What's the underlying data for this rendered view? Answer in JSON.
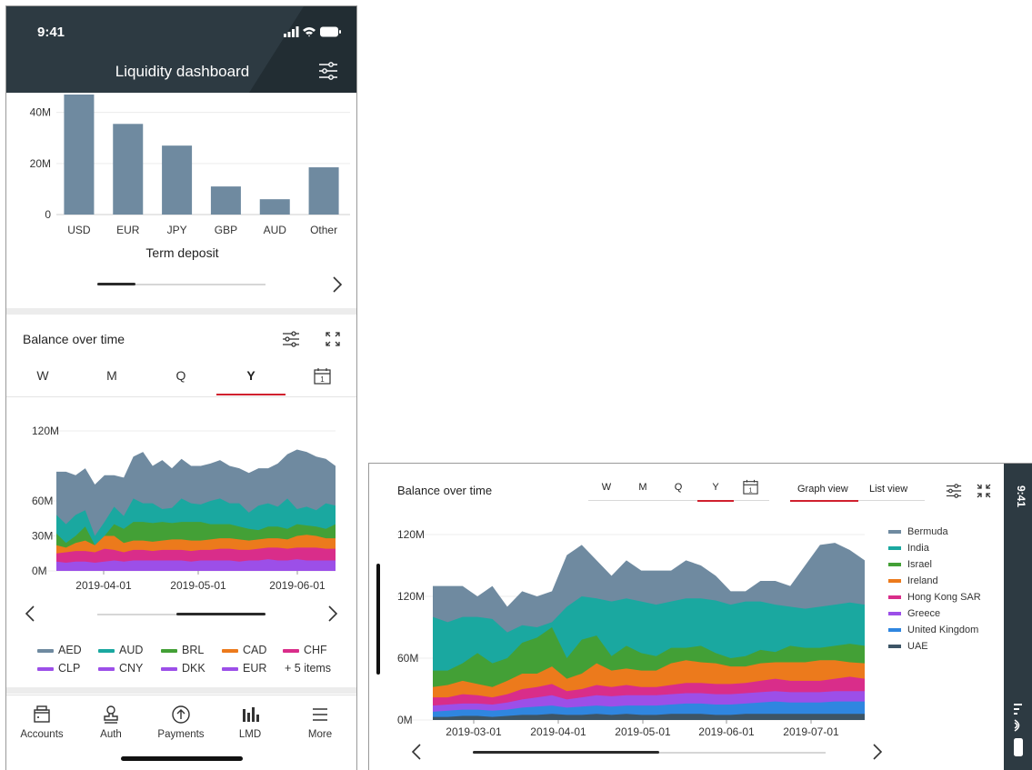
{
  "phone": {
    "status_time": "9:41",
    "header_title": "Liquidity dashboard",
    "filter_icon": "sliders-icon",
    "term_chart_title": "Term deposit",
    "balance_title": "Balance over time",
    "tabs": [
      "W",
      "M",
      "Q",
      "Y"
    ],
    "active_tab": "Y",
    "calendar_icon": "calendar-icon",
    "calendar_day": "1",
    "legend": [
      {
        "label": "AED",
        "color": "#6f8aa0"
      },
      {
        "label": "AUD",
        "color": "#1aa8a0"
      },
      {
        "label": "BRL",
        "color": "#43a036"
      },
      {
        "label": "CAD",
        "color": "#ec7a1c"
      },
      {
        "label": "CHF",
        "color": "#d92d8a"
      },
      {
        "label": "CLP",
        "color": "#9c4fe8"
      },
      {
        "label": "CNY",
        "color": "#9c4fe8"
      },
      {
        "label": "DKK",
        "color": "#9c4fe8"
      },
      {
        "label": "EUR",
        "color": "#9c4fe8"
      }
    ],
    "legend_more": "+ 5 items",
    "nav": [
      {
        "label": "Accounts",
        "icon": "accounts-icon"
      },
      {
        "label": "Auth",
        "icon": "auth-stamp-icon"
      },
      {
        "label": "Payments",
        "icon": "payments-icon"
      },
      {
        "label": "LMD",
        "icon": "lmd-bars-icon"
      },
      {
        "label": "More",
        "icon": "menu-icon"
      }
    ]
  },
  "landscape": {
    "title": "Balance over time",
    "tabs": [
      "W",
      "M",
      "Q",
      "Y"
    ],
    "active_tab": "Y",
    "calendar_day": "1",
    "views": [
      "Graph view",
      "List view"
    ],
    "active_view": "Graph view",
    "status_time": "9:41",
    "legend": [
      {
        "label": "Bermuda",
        "color": "#6f8aa0"
      },
      {
        "label": "India",
        "color": "#1aa8a0"
      },
      {
        "label": "Israel",
        "color": "#43a036"
      },
      {
        "label": "Ireland",
        "color": "#ec7a1c"
      },
      {
        "label": "Hong Kong SAR",
        "color": "#d92d8a"
      },
      {
        "label": "Greece",
        "color": "#9c4fe8"
      },
      {
        "label": "United Kingdom",
        "color": "#2f86e0"
      },
      {
        "label": "UAE",
        "color": "#3d5566"
      }
    ]
  },
  "chart_data": [
    {
      "type": "bar",
      "title": "Term deposit",
      "categories": [
        "USD",
        "EUR",
        "JPY",
        "GBP",
        "AUD",
        "Other"
      ],
      "values": [
        47,
        35.5,
        27,
        11,
        6,
        18.5
      ],
      "ylim": [
        0,
        47
      ],
      "yticks": [
        {
          "v": 0,
          "label": "0"
        },
        {
          "v": 20,
          "label": "20M"
        },
        {
          "v": 40,
          "label": "40M"
        }
      ],
      "grid": true,
      "bar_color": "#6f8aa0"
    },
    {
      "type": "area",
      "title": "Balance over time",
      "x_labels": [
        "2019-04-01",
        "2019-05-01",
        "2019-06-01"
      ],
      "y_ticks": [
        {
          "v": 0,
          "label": "0M"
        },
        {
          "v": 30,
          "label": "30M"
        },
        {
          "v": 60,
          "label": "60M"
        },
        {
          "v": 120,
          "label": "120M"
        }
      ],
      "ylim": [
        0,
        120
      ],
      "series": [
        {
          "name": "AED",
          "color": "#6f8aa0",
          "values": [
            85,
            85,
            82,
            88,
            74,
            82,
            82,
            80,
            98,
            102,
            90,
            95,
            88,
            96,
            90,
            90,
            92,
            95,
            90,
            88,
            84,
            88,
            88,
            92,
            100,
            104,
            102,
            98,
            96,
            90
          ]
        },
        {
          "name": "AUD",
          "color": "#1aa8a0",
          "values": [
            48,
            40,
            48,
            52,
            30,
            42,
            55,
            47,
            62,
            58,
            58,
            53,
            54,
            62,
            58,
            57,
            60,
            62,
            58,
            58,
            50,
            56,
            58,
            55,
            62,
            53,
            55,
            52,
            58,
            56
          ]
        },
        {
          "name": "BRL",
          "color": "#43a036",
          "values": [
            32,
            24,
            30,
            38,
            22,
            30,
            40,
            36,
            42,
            42,
            41,
            42,
            41,
            42,
            42,
            42,
            40,
            40,
            40,
            38,
            36,
            35,
            38,
            38,
            36,
            40,
            39,
            38,
            36,
            40
          ]
        },
        {
          "name": "CAD",
          "color": "#ec7a1c",
          "values": [
            22,
            20,
            24,
            26,
            22,
            30,
            30,
            24,
            26,
            26,
            25,
            26,
            27,
            27,
            26,
            26,
            27,
            28,
            28,
            27,
            26,
            27,
            28,
            28,
            27,
            30,
            31,
            30,
            28,
            28
          ]
        },
        {
          "name": "CHF",
          "color": "#d92d8a",
          "values": [
            15,
            16,
            17,
            17,
            16,
            19,
            18,
            16,
            18,
            18,
            17,
            18,
            18,
            18,
            17,
            18,
            18,
            19,
            19,
            18,
            18,
            19,
            20,
            20,
            19,
            20,
            20,
            20,
            19,
            19
          ]
        },
        {
          "name": "EUR",
          "color": "#9c4fe8",
          "values": [
            8,
            7,
            8,
            8,
            7,
            8,
            9,
            8,
            9,
            9,
            9,
            9,
            9,
            9,
            8,
            9,
            9,
            9,
            9,
            8,
            9,
            9,
            10,
            9,
            9,
            10,
            9,
            9,
            9,
            9
          ]
        }
      ]
    },
    {
      "type": "area",
      "title": "Balance over time",
      "x_labels": [
        "2019-03-01",
        "2019-04-01",
        "2019-05-01",
        "2019-06-01",
        "2019-07-01"
      ],
      "y_ticks": [
        {
          "v": 0,
          "label": "0M"
        },
        {
          "v": 60,
          "label": "60M"
        },
        {
          "v": 120,
          "label": "120M"
        },
        {
          "v": 180,
          "label": "120M"
        }
      ],
      "ylim": [
        0,
        180
      ],
      "series": [
        {
          "name": "Bermuda",
          "color": "#6f8aa0",
          "values": [
            130,
            130,
            130,
            120,
            130,
            110,
            125,
            120,
            125,
            160,
            170,
            155,
            140,
            155,
            145,
            145,
            145,
            155,
            150,
            140,
            125,
            125,
            135,
            135,
            130,
            150,
            170,
            172,
            165,
            155
          ]
        },
        {
          "name": "India",
          "color": "#1aa8a0",
          "values": [
            100,
            95,
            100,
            100,
            98,
            85,
            92,
            90,
            95,
            110,
            120,
            118,
            115,
            118,
            115,
            112,
            115,
            118,
            118,
            116,
            112,
            115,
            115,
            112,
            110,
            108,
            110,
            112,
            114,
            112
          ]
        },
        {
          "name": "Israel",
          "color": "#43a036",
          "values": [
            48,
            48,
            55,
            65,
            55,
            60,
            75,
            80,
            90,
            60,
            78,
            82,
            62,
            72,
            65,
            62,
            70,
            70,
            72,
            65,
            60,
            62,
            68,
            66,
            72,
            70,
            70,
            72,
            74,
            72
          ]
        },
        {
          "name": "Ireland",
          "color": "#ec7a1c",
          "values": [
            32,
            34,
            38,
            35,
            32,
            38,
            45,
            45,
            52,
            40,
            45,
            55,
            48,
            50,
            48,
            48,
            55,
            58,
            56,
            55,
            52,
            52,
            55,
            56,
            56,
            56,
            58,
            58,
            56,
            55
          ]
        },
        {
          "name": "Hong Kong SAR",
          "color": "#d92d8a",
          "values": [
            22,
            22,
            25,
            24,
            22,
            25,
            30,
            32,
            35,
            28,
            30,
            34,
            32,
            34,
            32,
            32,
            34,
            36,
            36,
            35,
            35,
            36,
            38,
            40,
            38,
            38,
            38,
            40,
            42,
            40
          ]
        },
        {
          "name": "Greece",
          "color": "#9c4fe8",
          "values": [
            14,
            15,
            16,
            16,
            15,
            17,
            20,
            22,
            24,
            20,
            22,
            24,
            23,
            24,
            24,
            24,
            25,
            26,
            26,
            25,
            25,
            26,
            27,
            28,
            27,
            27,
            27,
            28,
            28,
            28
          ]
        },
        {
          "name": "United Kingdom",
          "color": "#2f86e0",
          "values": [
            8,
            9,
            10,
            10,
            9,
            10,
            12,
            13,
            14,
            12,
            13,
            14,
            13,
            14,
            14,
            14,
            15,
            16,
            16,
            15,
            15,
            16,
            17,
            18,
            17,
            17,
            17,
            18,
            18,
            18
          ]
        },
        {
          "name": "UAE",
          "color": "#3d5566",
          "values": [
            3,
            3,
            4,
            4,
            3,
            4,
            5,
            5,
            6,
            5,
            5,
            6,
            5,
            6,
            5,
            5,
            6,
            6,
            6,
            5,
            5,
            6,
            6,
            6,
            6,
            6,
            6,
            6,
            6,
            6
          ]
        }
      ]
    }
  ]
}
